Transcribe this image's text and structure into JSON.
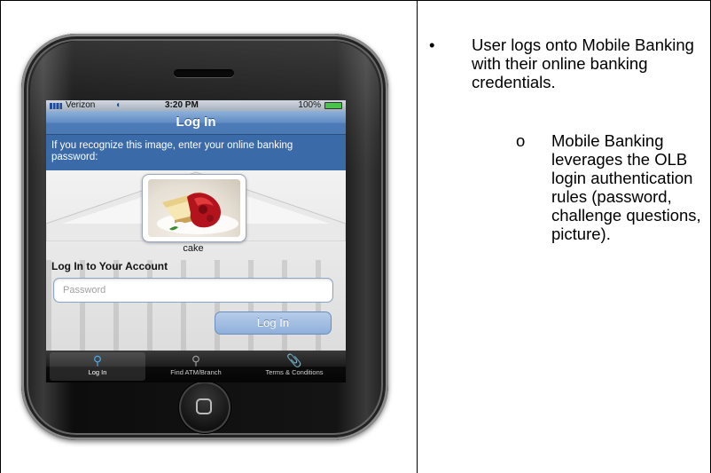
{
  "phone": {
    "status": {
      "carrier": "Verizon",
      "time": "3:20 PM",
      "battery": "100%"
    },
    "nav_title": "Log In",
    "prompt": "If you recognize this image, enter your online banking password:",
    "image_caption": "cake",
    "login_heading": "Log In to Your Account",
    "password_placeholder": "Password",
    "login_button": "Log In",
    "tabs": [
      {
        "label": "Log In",
        "icon": "key-icon",
        "active": true
      },
      {
        "label": "Find ATM/Branch",
        "icon": "search-icon",
        "active": false
      },
      {
        "label": "Terms & Conditions",
        "icon": "paperclip-icon",
        "active": false
      }
    ]
  },
  "notes": {
    "bullet_marker": "•",
    "bullet": "User logs onto Mobile Banking with their online banking credentials.",
    "sub_marker": "o",
    "sub_bullet": "Mobile Banking leverages the OLB login authentication rules (password, challenge questions, picture)."
  },
  "colors": {
    "nav_blue": "#5f8cc4",
    "prompt_blue": "#3a6aa8",
    "tab_active": "#4aa8e8"
  }
}
